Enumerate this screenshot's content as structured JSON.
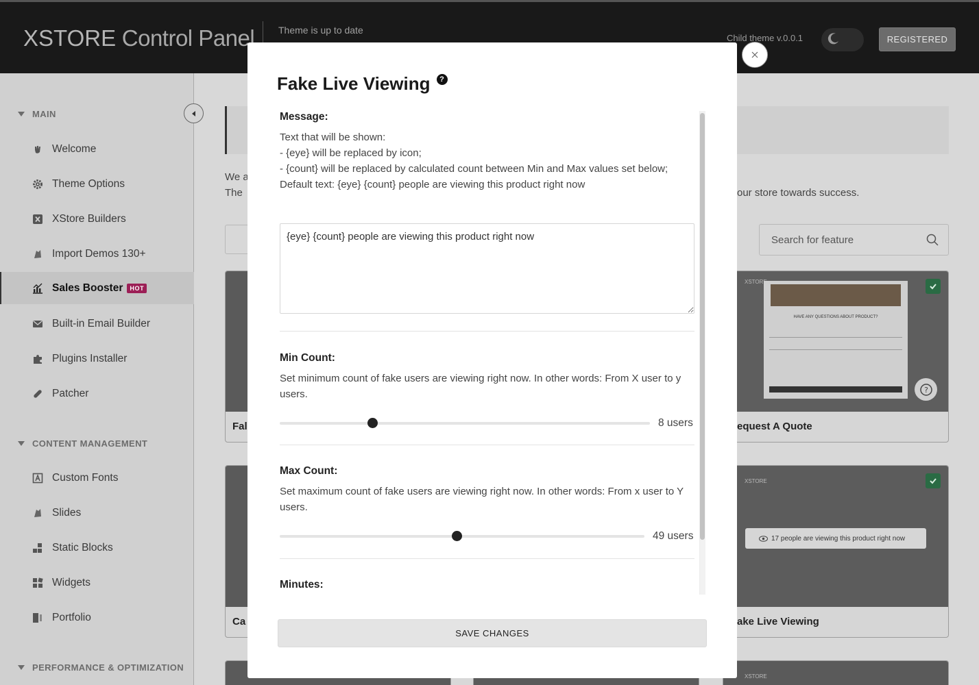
{
  "header": {
    "logo_brand": "XSTORE",
    "logo_suffix": " Control Panel",
    "theme_status": "Theme is up to date",
    "child_theme": "Child theme v.0.0.1",
    "registered_label": "REGISTERED"
  },
  "sidebar": {
    "sections": [
      {
        "title": "MAIN"
      },
      {
        "title": "CONTENT MANAGEMENT"
      },
      {
        "title": "PERFORMANCE & OPTIMIZATION"
      }
    ],
    "main_items": [
      {
        "label": "Welcome",
        "icon": "hand-wave-icon"
      },
      {
        "label": "Theme Options",
        "icon": "gear-icon"
      },
      {
        "label": "XStore Builders",
        "icon": "x-box-icon"
      },
      {
        "label": "Import Demos 130+",
        "icon": "layers-icon"
      },
      {
        "label": "Sales Booster",
        "icon": "chart-icon",
        "badge": "HOT"
      },
      {
        "label": "Built-in Email Builder",
        "icon": "envelope-icon"
      },
      {
        "label": "Plugins Installer",
        "icon": "puzzle-icon"
      },
      {
        "label": "Patcher",
        "icon": "bandage-icon"
      }
    ],
    "content_items": [
      {
        "label": "Custom Fonts",
        "icon": "font-icon"
      },
      {
        "label": "Slides",
        "icon": "slides-icon"
      },
      {
        "label": "Static Blocks",
        "icon": "blocks-icon"
      },
      {
        "label": "Widgets",
        "icon": "widgets-icon"
      },
      {
        "label": "Portfolio",
        "icon": "portfolio-icon"
      }
    ]
  },
  "main": {
    "intro_line1": "We a",
    "intro_line2": "The",
    "intro_end": "our store towards success.",
    "search_placeholder": "Search for feature",
    "cards": [
      {
        "title": "Fal"
      },
      {
        "title": "equest A Quote"
      },
      {
        "title": "Ca"
      },
      {
        "title": "ake Live Viewing"
      }
    ],
    "card_preview_brand": "XSTORE",
    "quote_preview_heading": "HAVE ANY QUESTIONS ABOUT PRODUCT?",
    "viewing_preview_text": "17 people are viewing this product right now"
  },
  "modal": {
    "title": "Fake Live Viewing",
    "help_glyph": "?",
    "message_label": "Message:",
    "message_desc": [
      "Text that will be shown:",
      "- {eye} will be replaced by icon;",
      "- {count} will be replaced by calculated count between Min and Max values set below;",
      "Default text: {eye} {count} people are viewing this product right now"
    ],
    "message_value": "{eye} {count} people are viewing this product right now",
    "min_label": "Min Count:",
    "min_desc": "Set minimum count of fake users are viewing right now. In other words: From X user to y users.",
    "min_value_label": "8 users",
    "min_fraction": 0.25,
    "max_label": "Max Count:",
    "max_desc": "Set maximum count of fake users are viewing right now. In other words: From x user to Y users.",
    "max_value_label": "49 users",
    "max_fraction": 0.485,
    "minutes_label": "Minutes:",
    "save_label": "SAVE CHANGES"
  },
  "colors": {
    "header_bg": "#191919",
    "hot_badge": "#9c1f56",
    "check_green": "#2a6b44"
  }
}
